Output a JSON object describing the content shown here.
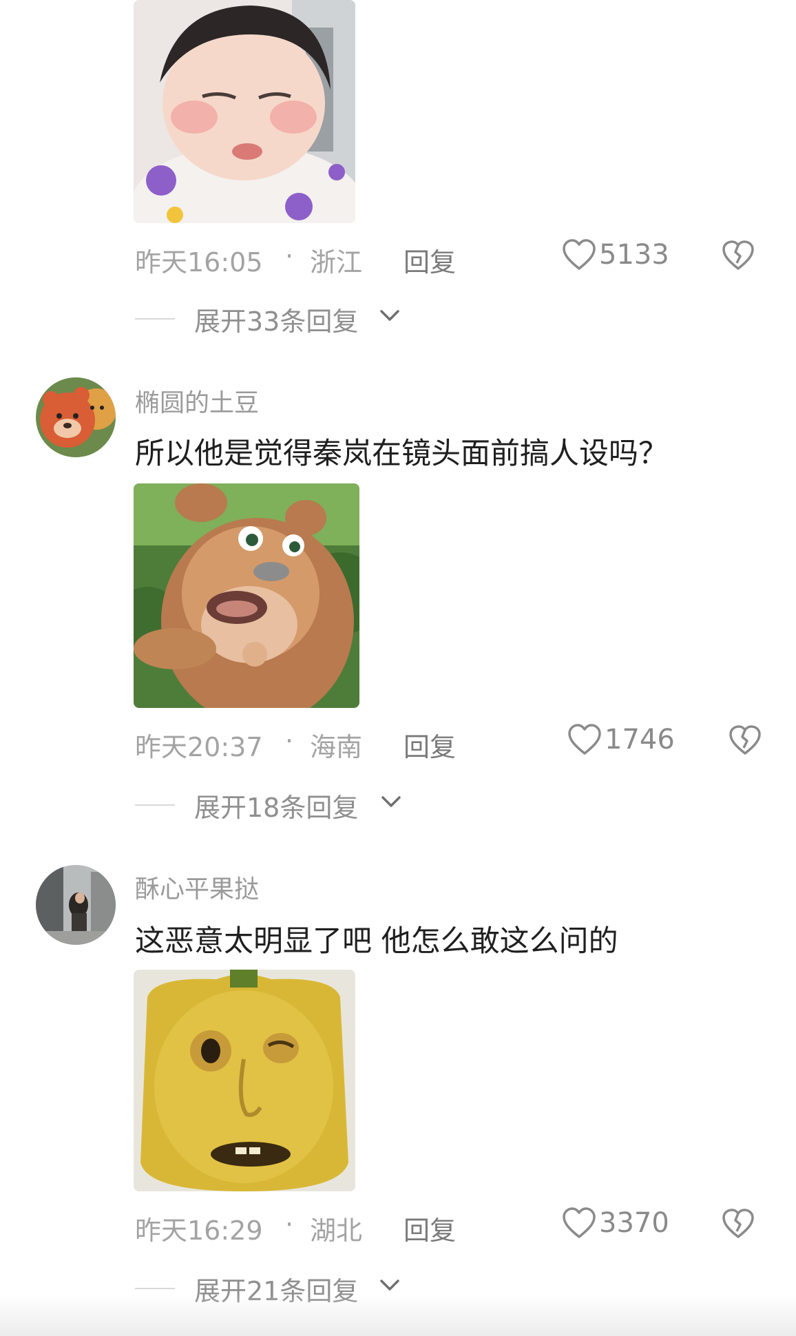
{
  "comments": [
    {
      "sticker_icon": "baby-face-sticker",
      "time": "昨天16:05",
      "location": "浙江",
      "reply_label": "回复",
      "likes": "5133",
      "expand_label": "展开33条回复"
    },
    {
      "avatar_icon": "cartoon-bear-avatar",
      "username": "椭圆的土豆",
      "text": "所以他是觉得秦岚在镜头面前搞人设吗？",
      "sticker_icon": "cartoon-bear-sticker",
      "time": "昨天20:37",
      "location": "海南",
      "reply_label": "回复",
      "likes": "1746",
      "expand_label": "展开18条回复"
    },
    {
      "avatar_icon": "photo-avatar",
      "username": "酥心平果挞",
      "text": "这恶意太明显了吧 他怎么敢这么问的",
      "sticker_icon": "yellow-pepper-face-sticker",
      "time": "昨天16:29",
      "location": "湖北",
      "reply_label": "回复",
      "likes": "3370",
      "expand_label": "展开21条回复"
    }
  ],
  "separator": "·",
  "colors": {
    "meta_text": "#a3a3a3",
    "reply_text": "#7a7a7a",
    "username": "#9a9a9a",
    "comment_text": "#1f1f1f"
  }
}
